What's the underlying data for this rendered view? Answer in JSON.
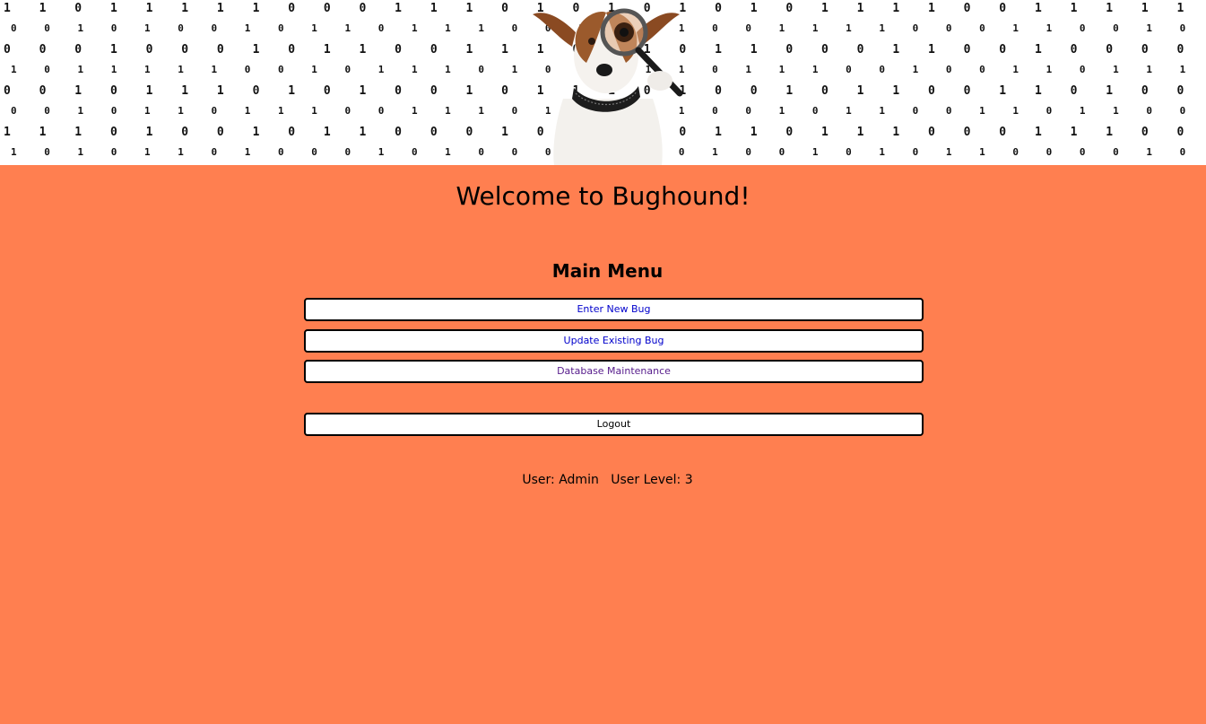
{
  "page": {
    "title": "Welcome to Bughound!"
  },
  "menu": {
    "heading": "Main Menu",
    "items": [
      {
        "label": "Enter New Bug"
      },
      {
        "label": "Update Existing Bug"
      },
      {
        "label": "Database Maintenance"
      }
    ],
    "logout_label": "Logout"
  },
  "status": {
    "user_label": "User:",
    "user_value": "Admin",
    "level_label": "User Level:",
    "level_value": "3"
  },
  "colors": {
    "background": "#ff7f50",
    "link": "#0000cc",
    "visited_link": "#551a8b"
  },
  "banner": {
    "image": "dog-with-magnifying-glass over binary digits",
    "binary_rows": [
      "1 1 0 1 1 1 1 1 0 0 0 1 1 1 0 1 0 1 0 1 0 1 0 1 1 1 1 0 0 1 1 1 1 1 1 0 1 0 1 1 1 0 1 1 0 1 1 0 0 1 1 1 0 1 0 1 0",
      "0 0 1 0 1 0 0 1 0 1 1 0 1 1 1 0 0 1 0 0 1 0 0 1 1 1 1 0 0 0 1 1 0 0 1 0 1 0 1 0 0 0 1 0 0 1 0 1 1 0 1 0 0 1 1 0 0",
      "0 0 0 1 0 0 0 1 0 1 1 0 0 1 1 1 0 0 1 0 1 1 0 0 0 1 1 0 0 1 0 0 0 0 0 1 0 0 1 1 0 1 0 1 1 0 0 0 0 1 0 1 1 1 0 1 1",
      "1 0 1 1 1 1 1 0 0 1 0 1 1 1 0 1 0 0 0 1 1 0 1 1 1 0 0 1 0 0 1 1 0 1 1 1 1 0 1 1 1 1 0 0 0 1 1 0 0 1 1 1 1 0 1 1 1",
      "0 0 1 0 1 1 1 0 1 0 1 0 0 1 0 1 1 1 0 1 0 0 1 0 1 1 0 0 1 1 0 1 0 0 1 0 0 1 0 1 1 0 1 1 1 0 1 0 1 0 1 1 0 1 1 0 1",
      "0 0 1 0 1 1 0 1 1 1 0 0 1 1 1 0 1 1 0 0 1 0 0 1 0 1 1 0 0 1 1 0 1 1 0 0 1 0 1 0 1 1 0 1 1 0 1 1 1 0 0 1 0 0 1 1 0",
      "1 1 1 0 1 0 0 1 0 1 1 0 0 0 1 0 1 1 0 0 1 1 0 1 1 1 0 0 0 1 1 1 0 0 1 0 1 1 0 1 1 0 1 0 1 0 1 0 1 1 1 0 0 0 1 0 1",
      "1 0 1 0 1 1 0 1 0 0 0 1 0 1 0 0 0 1 1 1 0 1 0 0 1 0 1 0 1 1 0 0 0 0 1 0 0 1 0 1 1 0 1 0 0 1 0 1 1 0 1 0 0 1 1 1 1"
    ]
  }
}
